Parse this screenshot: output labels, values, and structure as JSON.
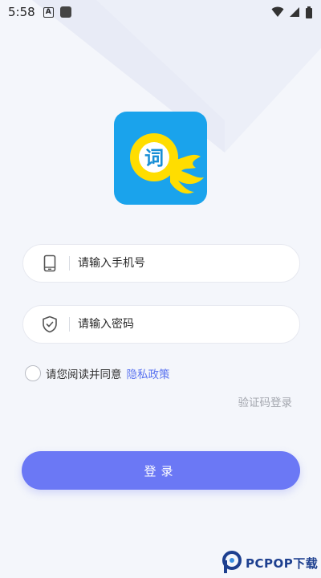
{
  "status_bar": {
    "time": "5:58",
    "notification_letter": "A",
    "icons": [
      "wifi-icon",
      "signal-icon",
      "battery-icon"
    ]
  },
  "logo": {
    "glyph": "词",
    "background": "#1aa3ec",
    "ring": "#ffdd00"
  },
  "form": {
    "phone_placeholder": "请输入手机号",
    "password_placeholder": "请输入密码",
    "phone_value": "",
    "password_value": ""
  },
  "agreement": {
    "text": "请您阅读并同意",
    "link": "隐私政策",
    "checked": false
  },
  "alt_login_label": "验证码登录",
  "login_button_label": "登录",
  "watermark": {
    "text": "PCPOP下载"
  },
  "colors": {
    "accent": "#6b78f5",
    "link": "#5a73f0",
    "background": "#f4f6fb"
  }
}
